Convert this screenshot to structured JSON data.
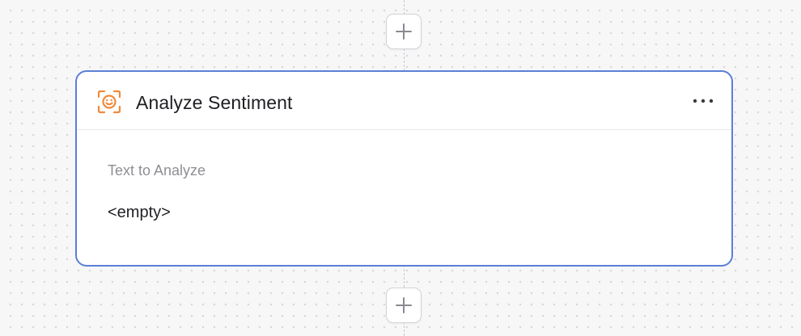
{
  "node": {
    "title": "Analyze Sentiment",
    "icon": "sentiment-face-icon",
    "field_label": "Text to Analyze",
    "field_value": "<empty>"
  },
  "colors": {
    "card_border": "#5b7fd6",
    "icon_accent": "#f08a3c",
    "label_text": "#8e8e96",
    "title_text": "#1f1f24"
  },
  "icons": {
    "add_step": "plus-icon",
    "more": "more-horizontal-icon"
  }
}
